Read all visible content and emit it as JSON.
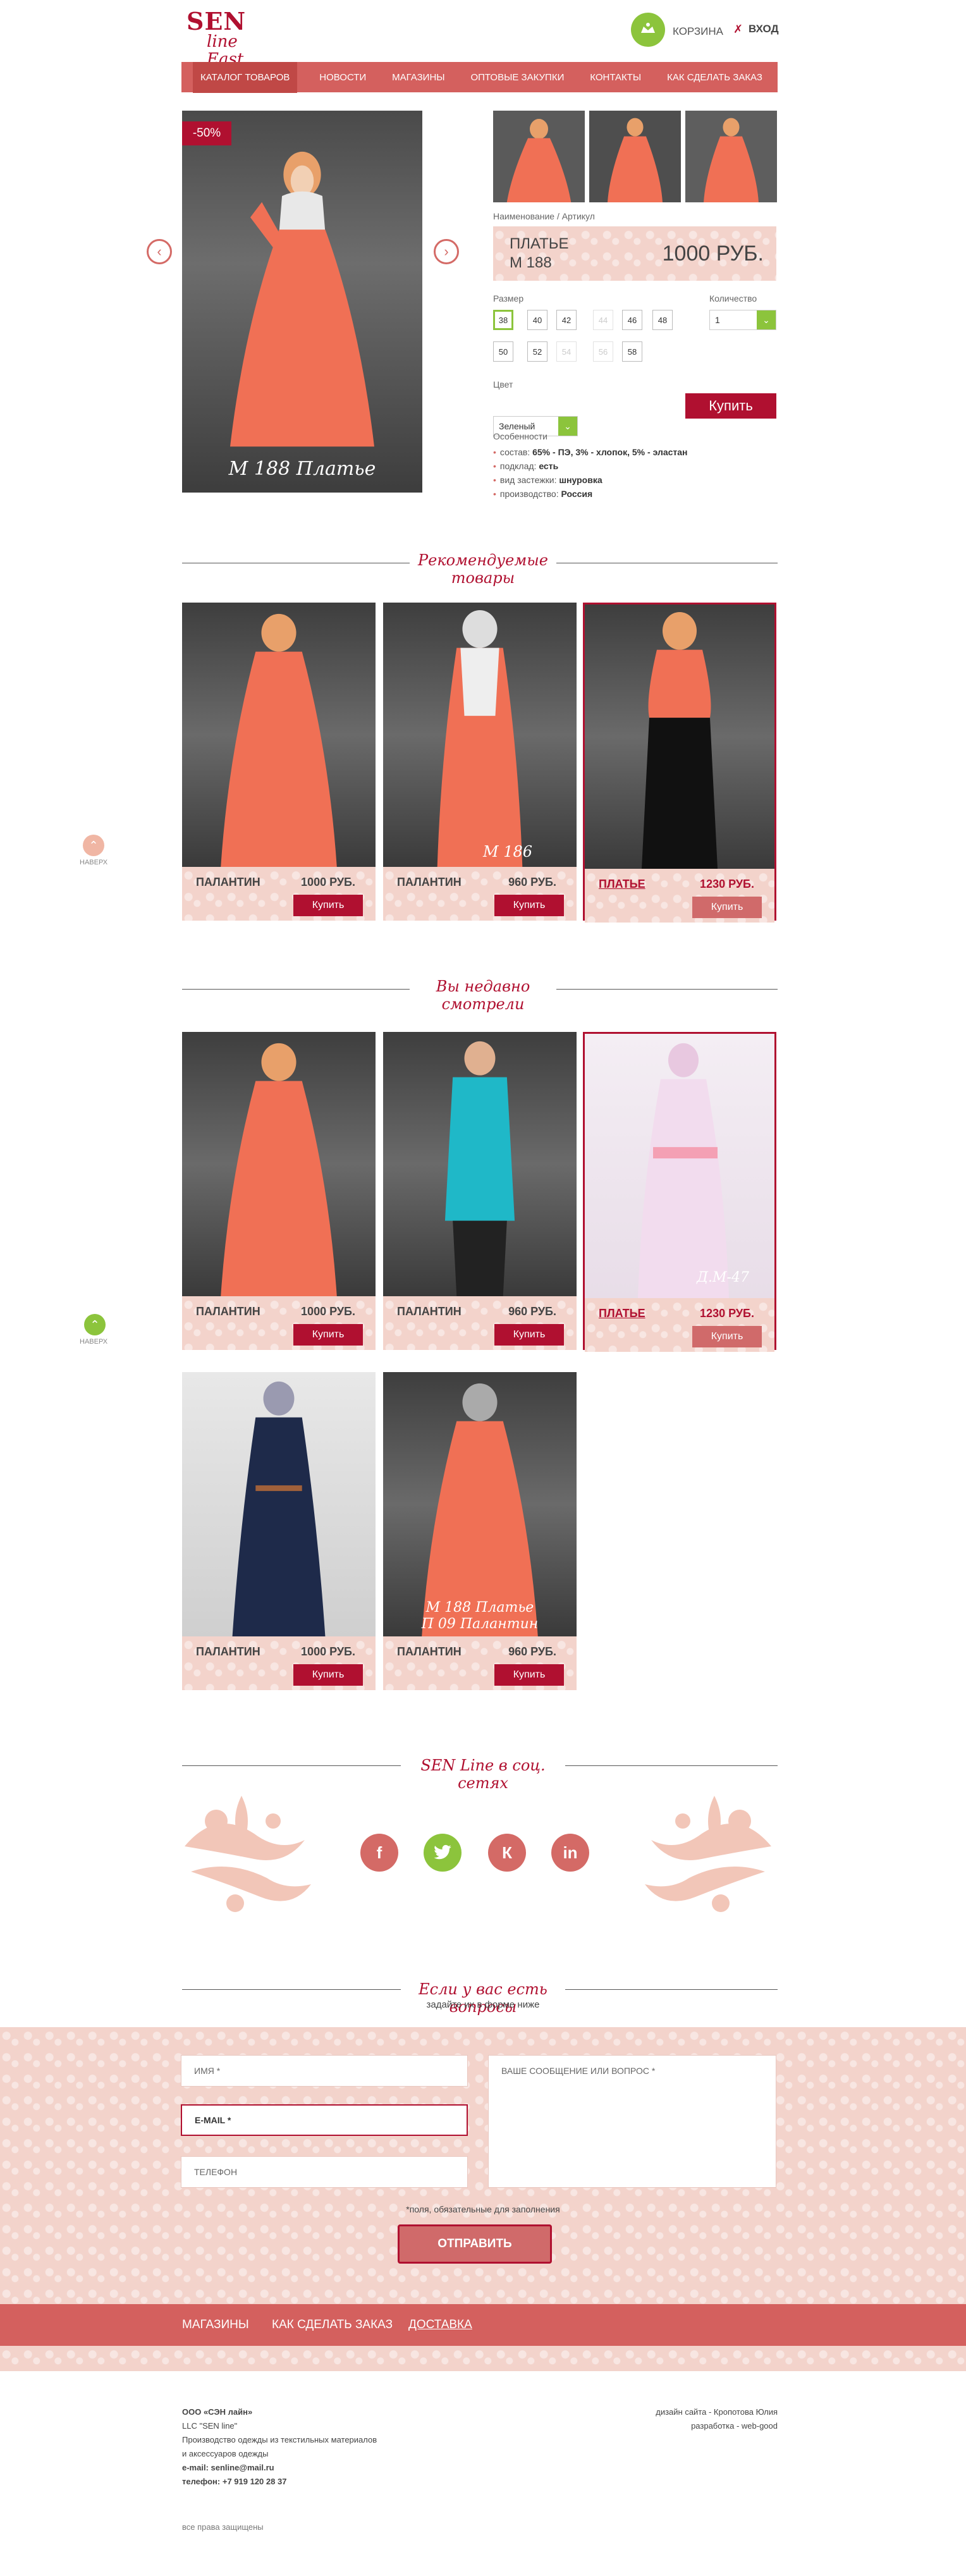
{
  "header": {
    "logo_line1": "SEN",
    "logo_line2": "line East",
    "cart_label": "КОРЗИНА",
    "login_label": "ВХОД"
  },
  "nav": [
    "КАТАЛОГ ТОВАРОВ",
    "НОВОСТИ",
    "МАГАЗИНЫ",
    "ОПТОВЫЕ ЗАКУПКИ",
    "КОНТАКТЫ",
    "КАК СДЕЛАТЬ ЗАКАЗ"
  ],
  "product": {
    "discount": "-50%",
    "image_caption": "М 188  Платье",
    "name_label": "Наименование / Артикул",
    "name": "ПЛАТЬЕ",
    "article": "М 188",
    "price": "1000 РУБ.",
    "size_label": "Размер",
    "sizes_row1": [
      "38",
      "40",
      "42",
      "44",
      "46",
      "48"
    ],
    "sizes_row2": [
      "50",
      "52",
      "54",
      "56",
      "58"
    ],
    "qty_label": "Количество",
    "qty_value": "1",
    "color_label": "Цвет",
    "color_value": "Зеленый",
    "buy_label": "Купить",
    "features_label": "Особенности",
    "features": [
      {
        "k": "состав: ",
        "v": "65% - ПЭ, 3% - хлопок, 5% - эластан"
      },
      {
        "k": "подклад: ",
        "v": "есть"
      },
      {
        "k": "вид застежки: ",
        "v": "шнуровка"
      },
      {
        "k": "производство: ",
        "v": "Россия"
      }
    ]
  },
  "recommended": {
    "title_line1": "Рекомендуемые",
    "title_line2": "товары",
    "items": [
      {
        "name": "ПАЛАНТИН",
        "price": "1000 РУБ.",
        "buy": "Купить",
        "caption": ""
      },
      {
        "name": "ПАЛАНТИН",
        "price": "960 РУБ.",
        "buy": "Купить",
        "caption": "М 186"
      },
      {
        "name": "ПЛАТЬЕ",
        "price": "1230 РУБ.",
        "buy": "Купить",
        "caption": ""
      }
    ]
  },
  "viewed": {
    "title_line1": "Вы недавно",
    "title_line2": "смотрели",
    "items": [
      {
        "name": "ПАЛАНТИН",
        "price": "1000 РУБ.",
        "buy": "Купить",
        "caption": ""
      },
      {
        "name": "ПАЛАНТИН",
        "price": "960 РУБ.",
        "buy": "Купить",
        "caption": ""
      },
      {
        "name": "ПЛАТЬЕ",
        "price": "1230 РУБ.",
        "buy": "Купить",
        "caption": "Д.М-47"
      },
      {
        "name": "ПАЛАНТИН",
        "price": "1000 РУБ.",
        "buy": "Купить",
        "caption": ""
      },
      {
        "name": "ПАЛАНТИН",
        "price": "960 РУБ.",
        "buy": "Купить",
        "caption": "М 188 Платье\nП 09 Палантин"
      }
    ]
  },
  "up_label": "НАВЕРХ",
  "social": {
    "title": "SEN Line в соц. сетях",
    "icons": [
      "f",
      "t",
      "К",
      "in"
    ]
  },
  "form": {
    "title": "Если у вас есть вопросы",
    "subtitle": "задайте их в форме ниже",
    "name_placeholder": "ИМЯ *",
    "email_placeholder": "E-MAIL *",
    "phone_placeholder": "ТЕЛЕФОН",
    "message_placeholder": "ВАШЕ СООБЩЕНИЕ ИЛИ ВОПРОС *",
    "required_note": "*поля, обязательные для заполнения",
    "send_label": "ОТПРАВИТЬ"
  },
  "footer_nav": [
    "МАГАЗИНЫ",
    "КАК СДЕЛАТЬ ЗАКАЗ",
    "ДОСТАВКА"
  ],
  "footer": {
    "company": "ООО «СЭН лайн»",
    "company_en": "LLC \"SEN line\"",
    "desc1": "Производство одежды из текстильных материалов",
    "desc2": "и аксессуаров одежды",
    "email": "e-mail: senline@mail.ru",
    "phone": "телефон: +7 919 120 28 37",
    "design": "дизайн сайта - Кропотова Юлия",
    "dev": "разработка - web-good",
    "rights": "все права защищены"
  },
  "colors": {
    "accent": "#b01030",
    "nav": "#d4605e",
    "green": "#8cc43c",
    "pink": "#f3d3cb"
  }
}
